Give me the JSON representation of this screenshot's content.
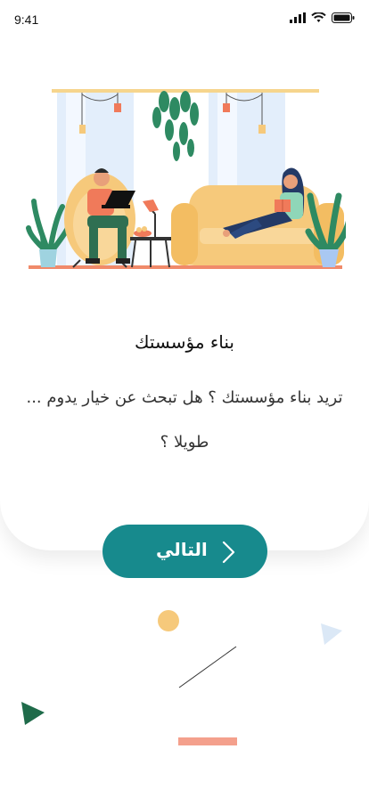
{
  "status_bar": {
    "time": "9:41"
  },
  "onboarding": {
    "title": "بناء مؤسستك",
    "description": "تريد بناء مؤسستك ؟ هل تبحث عن خيار يدوم ... طويلا ؟"
  },
  "actions": {
    "next_label": "التالي"
  },
  "colors": {
    "primary": "#178a8d",
    "circle": "#f6c97b",
    "triangle_dark": "#1f6b4a",
    "triangle_light": "#dbe8f6",
    "bar": "#f4a08c"
  },
  "icons": {
    "signal": "signal-icon",
    "wifi": "wifi-icon",
    "battery": "battery-icon",
    "next": "chevron-right-icon"
  }
}
